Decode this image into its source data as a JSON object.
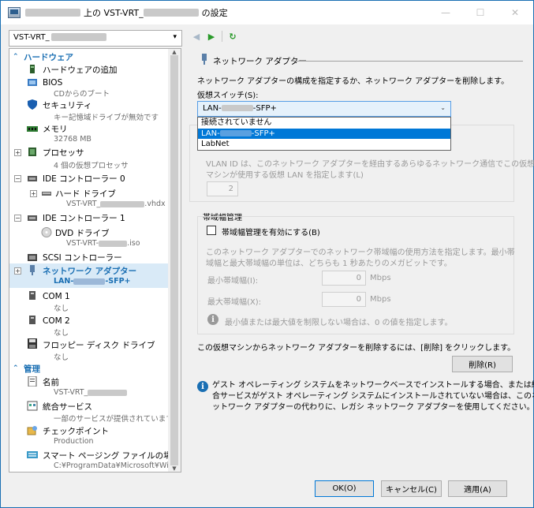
{
  "window": {
    "title_suffix": "上の VST-VRT_",
    "title_end": "の設定",
    "minimize": "—",
    "maximize": "☐",
    "close": "✕"
  },
  "toolbar": {
    "vm_name": "VST-VRT_",
    "caret": "▾",
    "back": "◀",
    "forward": "▶",
    "refresh": "↻"
  },
  "tree": {
    "hardware_header": "ハードウェア",
    "management_header": "管理",
    "items": [
      {
        "label": "ハードウェアの追加",
        "sub": ""
      },
      {
        "label": "BIOS",
        "sub": "CDからのブート"
      },
      {
        "label": "セキュリティ",
        "sub": "キー記憶域ドライブが無効です"
      },
      {
        "label": "メモリ",
        "sub": "32768 MB"
      },
      {
        "label": "プロセッサ",
        "sub": "4 個の仮想プロセッサ"
      },
      {
        "label": "IDE コントローラー 0",
        "sub": ""
      },
      {
        "label": "ハード ドライブ",
        "sub_prefix": "VST-VRT_",
        "sub_suffix": ".vhdx"
      },
      {
        "label": "IDE コントローラー 1",
        "sub": ""
      },
      {
        "label": "DVD ドライブ",
        "sub_prefix": "VST-VRT-",
        "sub_suffix": ".iso"
      },
      {
        "label": "SCSI コントローラー",
        "sub": ""
      },
      {
        "label": "ネットワーク アダプター",
        "sub_prefix": "LAN-",
        "sub_suffix": "-SFP+"
      },
      {
        "label": "COM 1",
        "sub": "なし"
      },
      {
        "label": "COM 2",
        "sub": "なし"
      },
      {
        "label": "フロッピー ディスク ドライブ",
        "sub": "なし"
      },
      {
        "label": "名前",
        "sub_prefix": "VST-VRT_",
        "sub_suffix": ""
      },
      {
        "label": "統合サービス",
        "sub": "一部のサービスが提供されています"
      },
      {
        "label": "チェックポイント",
        "sub": "Production"
      },
      {
        "label": "スマート ページング ファイルの場所",
        "sub": "C:¥ProgramData¥Microsoft¥Wi..."
      }
    ]
  },
  "panel": {
    "group_title": "ネットワーク アダプター",
    "description": "ネットワーク アダプターの構成を指定するか、ネットワーク アダプターを削除します。",
    "vswitch_label": "仮想スイッチ(S):",
    "vswitch_value_prefix": "LAN-",
    "vswitch_value_suffix": "-SFP+",
    "vswitch_options": [
      {
        "text": "接続されていません"
      },
      {
        "text_prefix": "LAN-",
        "text_suffix": "-SFP+"
      },
      {
        "text": "LabNet"
      }
    ],
    "vlan_desc_1": "VLAN ID は、このネットワーク アダプターを経由するあらゆるネットワーク通信でこの仮想",
    "vlan_desc_2": "マシンが使用する仮想 LAN を指定します(L)",
    "vlan_value": "2",
    "bandwidth_title": "帯域幅管理",
    "bandwidth_checkbox": "帯域幅管理を有効にする(B)",
    "bandwidth_desc_1": "このネットワーク アダプターでのネットワーク帯域幅の使用方法を指定します。最小帯",
    "bandwidth_desc_2": "域幅と最大帯域幅の単位は、どちらも 1 秒あたりのメガビットです。",
    "min_label": "最小帯域幅(I):",
    "min_value": "0",
    "max_label": "最大帯域幅(X):",
    "max_value": "0",
    "unit": "Mbps",
    "bandwidth_note": "最小値または最大値を制限しない場合は、0 の値を指定します。",
    "remove_desc": "この仮想マシンからネットワーク アダプターを削除するには、[削除] をクリックします。",
    "remove_button": "削除(R)",
    "info_1": "ゲスト オペレーティング システムをネットワークベースでインストールする場合、または統",
    "info_2": "合サービスがゲスト オペレーティング システムにインストールされていない場合は、このネ",
    "info_3": "ットワーク アダプターの代わりに、レガシ ネットワーク アダプターを使用してください。"
  },
  "footer": {
    "ok": "OK(O)",
    "cancel": "キャンセル(C)",
    "apply": "適用(A)"
  }
}
